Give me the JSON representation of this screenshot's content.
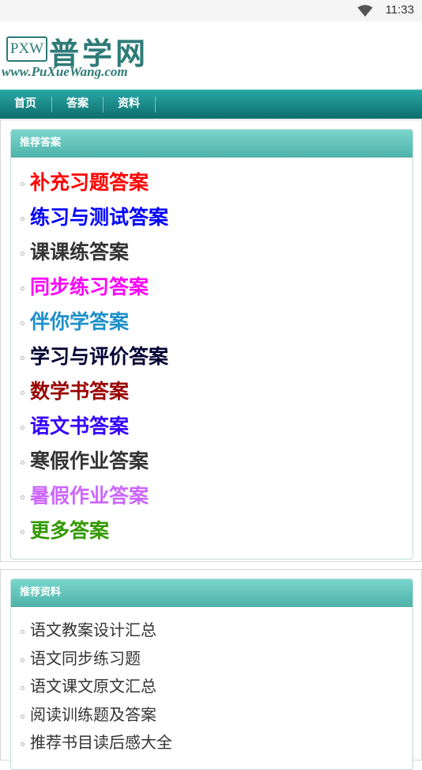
{
  "status_bar": {
    "time": "11:33",
    "wifi_icon": "wifi-icon"
  },
  "logo": {
    "badge": "PXW",
    "name": "普学网",
    "url": "www.PuXueWang.com"
  },
  "nav": {
    "items": [
      "首页",
      "答案",
      "资料"
    ]
  },
  "recommended_answers": {
    "title": "推荐答案",
    "items": [
      {
        "label": "补充习题答案",
        "color": "#ff0000"
      },
      {
        "label": "练习与测试答案",
        "color": "#0000ff"
      },
      {
        "label": "课课练答案",
        "color": "#333333"
      },
      {
        "label": "同步练习答案",
        "color": "#ff00ff"
      },
      {
        "label": "伴你学答案",
        "color": "#1e90c8"
      },
      {
        "label": "学习与评价答案",
        "color": "#000033"
      },
      {
        "label": "数学书答案",
        "color": "#990000"
      },
      {
        "label": "语文书答案",
        "color": "#3300ff"
      },
      {
        "label": "寒假作业答案",
        "color": "#333333"
      },
      {
        "label": "暑假作业答案",
        "color": "#cc66ff"
      },
      {
        "label": "更多答案",
        "color": "#339900"
      }
    ]
  },
  "recommended_materials": {
    "title": "推荐资料",
    "items": [
      "语文教案设计汇总",
      "语文同步练习题",
      "语文课文原文汇总",
      "阅读训练题及答案",
      "推荐书目读后感大全"
    ]
  }
}
